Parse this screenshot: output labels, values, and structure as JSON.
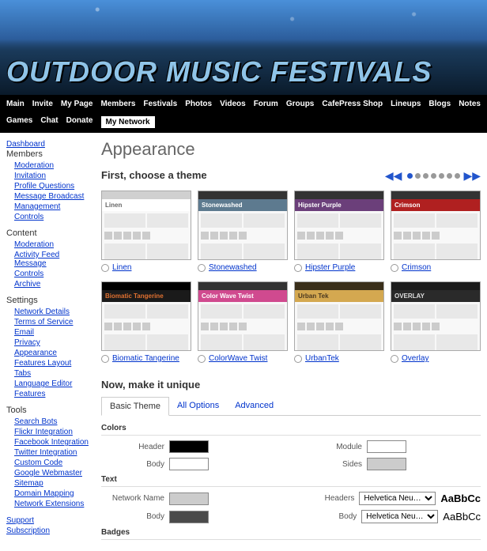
{
  "site_title": "OUTDOOR MUSIC FESTIVALS",
  "nav": [
    "Main",
    "Invite",
    "My Page",
    "Members",
    "Festivals",
    "Photos",
    "Videos",
    "Forum",
    "Groups",
    "CafePress Shop",
    "Lineups",
    "Blogs",
    "Notes",
    "Games",
    "Chat",
    "Donate",
    "My Network"
  ],
  "nav_active": "My Network",
  "sidebar": {
    "dashboard": "Dashboard",
    "groups": [
      {
        "head": "Members",
        "links": [
          "Moderation",
          "Invitation",
          "Profile Questions",
          "Message Broadcast",
          "Management",
          "Controls"
        ]
      },
      {
        "head": "Content",
        "links": [
          "Moderation",
          "Activity Feed Message",
          "Controls",
          "Archive"
        ]
      },
      {
        "head": "Settings",
        "links": [
          "Network Details",
          "Terms of Service",
          "Email",
          "Privacy",
          "Appearance",
          "Features Layout",
          "Tabs",
          "Language Editor",
          "Features"
        ]
      },
      {
        "head": "Tools",
        "links": [
          "Search Bots",
          "Flickr Integration",
          "Facebook Integration",
          "Twitter Integration",
          "Custom Code",
          "Google Webmaster",
          "Sitemap",
          "Domain Mapping",
          "Network Extensions"
        ]
      }
    ],
    "support": "Support",
    "subscription": "Subscription"
  },
  "page_title": "Appearance",
  "theme_section_title": "First, choose a theme",
  "themes": [
    {
      "name": "Linen",
      "title_strip": "Linen",
      "bar": "#d0d0d0",
      "strip_bg": "#ffffff",
      "strip_fg": "#666"
    },
    {
      "name": "Stonewashed",
      "title_strip": "Stonewashed",
      "bar": "#333",
      "strip_bg": "#5d7a8f",
      "strip_fg": "#fff"
    },
    {
      "name": "Hipster Purple",
      "title_strip": "Hipster Purple",
      "bar": "#333",
      "strip_bg": "#6b3f7a",
      "strip_fg": "#fff"
    },
    {
      "name": "Crimson",
      "title_strip": "Crimson",
      "bar": "#333",
      "strip_bg": "#b02020",
      "strip_fg": "#fff"
    },
    {
      "name": "Biomatic Tangerine",
      "title_strip": "Biomatic Tangerine",
      "bar": "#000",
      "strip_bg": "#1a1a1a",
      "strip_fg": "#e07030"
    },
    {
      "name": "ColorWave Twist",
      "title_strip": "Color Wave Twist",
      "bar": "#333",
      "strip_bg": "#d04a8f",
      "strip_fg": "#fff"
    },
    {
      "name": "UrbanTek",
      "title_strip": "Urban Tek",
      "bar": "#3a2f1a",
      "strip_bg": "#d4a850",
      "strip_fg": "#4a3820"
    },
    {
      "name": "Overlay",
      "title_strip": "OVERLAY",
      "bar": "#1a1a1a",
      "strip_bg": "#2a2a2a",
      "strip_fg": "#ddd"
    }
  ],
  "unique_section_title": "Now, make it unique",
  "tabs": [
    "Basic Theme",
    "All Options",
    "Advanced"
  ],
  "tab_active": "Basic Theme",
  "form": {
    "colors_label": "Colors",
    "text_label": "Text",
    "badges_label": "Badges",
    "header_label": "Header",
    "body_label": "Body",
    "module_label": "Module",
    "sides_label": "Sides",
    "network_name_label": "Network Name",
    "headers_label": "Headers",
    "colors": {
      "header": "#000000",
      "body": "#ffffff",
      "module": "#ffffff",
      "sides": "#cccccc"
    },
    "text_colors": {
      "network_name": "#cccccc",
      "body": "#4a4a4a"
    },
    "fonts": {
      "headers": "Helvetica Neu…",
      "body": "Helvetica Neu…"
    },
    "sample_bold": "AaBbCc",
    "sample": "AaBbCc"
  },
  "carousel": {
    "pages": 7,
    "active": 0
  }
}
